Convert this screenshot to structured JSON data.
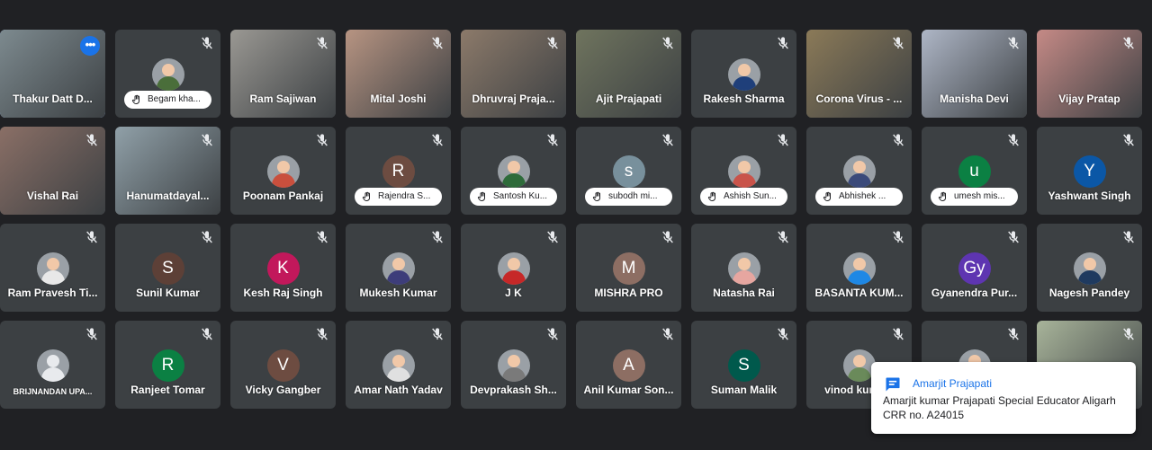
{
  "participants": [
    {
      "name": "Thakur Datt D...",
      "kind": "video",
      "bg": "#7d8a8f",
      "active": true,
      "more": true
    },
    {
      "name": "Begam kha...",
      "kind": "photo",
      "hand": true,
      "shirt": "#4a6e3a"
    },
    {
      "name": "Ram Sajiwan",
      "kind": "video",
      "bg": "#9a9893"
    },
    {
      "name": "Mital Joshi",
      "kind": "video",
      "bg": "#b79482"
    },
    {
      "name": "Dhruvraj Praja...",
      "kind": "video",
      "bg": "#8c7a6a"
    },
    {
      "name": "Ajit Prajapati",
      "kind": "video",
      "bg": "#6f745e"
    },
    {
      "name": "Rakesh Sharma",
      "kind": "photo",
      "shirt": "#1f3f7a"
    },
    {
      "name": "Corona Virus - ...",
      "kind": "video",
      "bg": "#8b7a58"
    },
    {
      "name": "Manisha Devi",
      "kind": "video",
      "bg": "#aeb6c6"
    },
    {
      "name": "Vijay Pratap",
      "kind": "video",
      "bg": "#c58a86"
    },
    {
      "name": "Vishal Rai",
      "kind": "video",
      "bg": "#8a6f66"
    },
    {
      "name": "Hanumatdayal...",
      "kind": "video",
      "bg": "#90a0a8"
    },
    {
      "name": "Poonam Pankaj",
      "kind": "photo",
      "shirt": "#c94f3d"
    },
    {
      "name": "Rajendra S...",
      "kind": "letter",
      "letter": "R",
      "color": "#6d4c41",
      "hand": true
    },
    {
      "name": "Santosh Ku...",
      "kind": "photo",
      "hand": true,
      "shirt": "#2e6b3a"
    },
    {
      "name": "subodh mi...",
      "kind": "letter",
      "letter": "s",
      "color": "#78909c",
      "hand": true
    },
    {
      "name": "Ashish Sun...",
      "kind": "photo",
      "hand": true,
      "shirt": "#c9534a"
    },
    {
      "name": "Abhishek ...",
      "kind": "photo",
      "hand": true,
      "shirt": "#3b4a7a"
    },
    {
      "name": "umesh mis...",
      "kind": "letter",
      "letter": "u",
      "color": "#0b8043",
      "hand": true
    },
    {
      "name": "Yashwant Singh",
      "kind": "letter",
      "letter": "Y",
      "color": "#0b57a6"
    },
    {
      "name": "Ram Pravesh Ti...",
      "kind": "photo",
      "shirt": "#e8e8e8"
    },
    {
      "name": "Sunil Kumar",
      "kind": "letter",
      "letter": "S",
      "color": "#5d4037"
    },
    {
      "name": "Kesh Raj Singh",
      "kind": "letter",
      "letter": "K",
      "color": "#c2185b"
    },
    {
      "name": "Mukesh Kumar",
      "kind": "photo",
      "shirt": "#3d3d7a"
    },
    {
      "name": "J K",
      "kind": "photo",
      "shirt": "#c62828"
    },
    {
      "name": "MISHRA PRO",
      "kind": "letter",
      "letter": "M",
      "color": "#8d6e63"
    },
    {
      "name": "Natasha Rai",
      "kind": "photo",
      "shirt": "#e6a6a0"
    },
    {
      "name": "BASANTA KUM...",
      "kind": "photo",
      "shirt": "#1e88e5"
    },
    {
      "name": "Gyanendra Pur...",
      "kind": "letter",
      "letter": "Gy",
      "color": "#5e35b1"
    },
    {
      "name": "Nagesh Pandey",
      "kind": "photo",
      "shirt": "#1f3a5f"
    },
    {
      "name": "BRIJNANDAN UPA...",
      "kind": "default",
      "small": true
    },
    {
      "name": "Ranjeet Tomar",
      "kind": "letter",
      "letter": "R",
      "color": "#0b8043"
    },
    {
      "name": "Vicky Gangber",
      "kind": "letter",
      "letter": "V",
      "color": "#6d4c41"
    },
    {
      "name": "Amar Nath Yadav",
      "kind": "photo",
      "shirt": "#e0e0e0"
    },
    {
      "name": "Devprakash Sh...",
      "kind": "photo",
      "shirt": "#7a7a7a"
    },
    {
      "name": "Anil Kumar Son...",
      "kind": "letter",
      "letter": "A",
      "color": "#8d6e63"
    },
    {
      "name": "Suman Malik",
      "kind": "letter",
      "letter": "S",
      "color": "#00594c"
    },
    {
      "name": "vinod kuma...",
      "kind": "photo",
      "shirt": "#6a8a5a"
    },
    {
      "name": "",
      "kind": "photo",
      "shirt": "#a07060"
    },
    {
      "name": "",
      "kind": "video",
      "bg": "#a8b49a"
    }
  ],
  "toast": {
    "sender": "Amarjit Prajapati",
    "message": "Amarjit kumar Prajapati  Special Educator Aligarh CRR no. A24015"
  },
  "colors": {
    "page_bg": "#202124",
    "tile_bg": "#3c4043",
    "accent": "#1a73e8"
  }
}
